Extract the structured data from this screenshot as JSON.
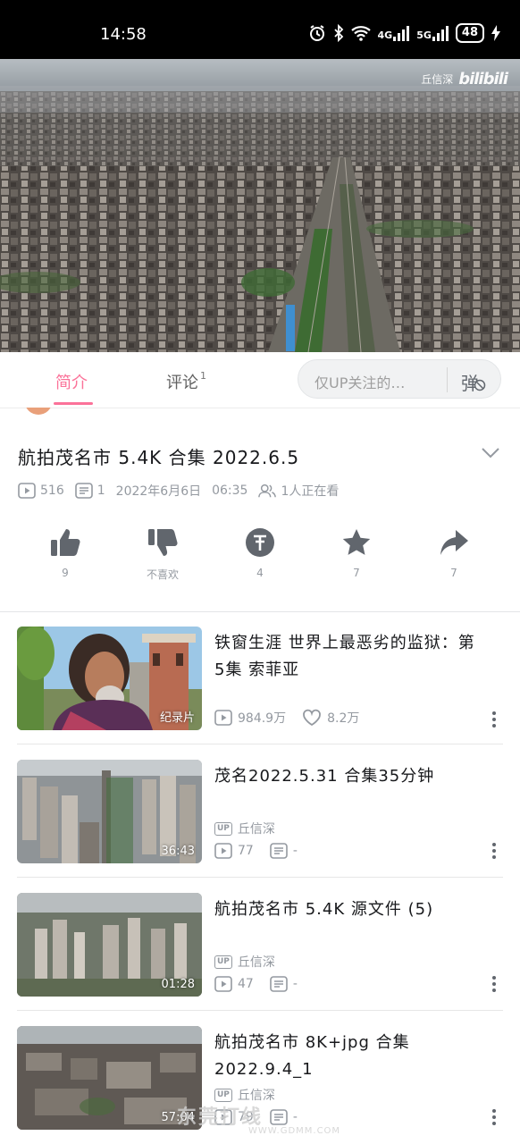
{
  "status_bar": {
    "time": "14:58",
    "network_4g": "4G",
    "network_5g": "5G",
    "battery": "48",
    "icons": [
      "alarm-icon",
      "bluetooth-icon",
      "wifi-icon",
      "signal-icon",
      "battery-icon",
      "charging-icon"
    ]
  },
  "video": {
    "uploader_watermark": "丘信深",
    "logo": "bilibili"
  },
  "tabs": {
    "intro": "简介",
    "comments": "评论",
    "comments_count": "1",
    "danmaku_placeholder": "仅UP关注的…",
    "danmaku_toggle": "弹"
  },
  "video_info": {
    "title": "航拍茂名市 5.4K 合集 2022.6.5",
    "views": "516",
    "danmaku_count": "1",
    "date": "2022年6月6日",
    "time": "06:35",
    "watching": "1人正在看"
  },
  "actions": [
    {
      "name": "like",
      "label": "9"
    },
    {
      "name": "dislike",
      "label": "不喜欢"
    },
    {
      "name": "coin",
      "label": "4"
    },
    {
      "name": "favorite",
      "label": "7"
    },
    {
      "name": "share",
      "label": "7"
    }
  ],
  "related": [
    {
      "title": "铁窗生涯 世界上最恶劣的监狱：第5集 索菲亚",
      "badge": "纪录片",
      "views": "984.9万",
      "likes": "8.2万"
    },
    {
      "title": "茂名2022.5.31  合集35分钟",
      "duration": "36:43",
      "up_badge": "UP",
      "uploader": "丘信深",
      "views": "77",
      "danmaku": "-"
    },
    {
      "title": "航拍茂名市 5.4K 源文件 (5)",
      "duration": "01:28",
      "up_badge": "UP",
      "uploader": "丘信深",
      "views": "47",
      "danmaku": "-"
    },
    {
      "title": "航拍茂名市 8K+jpg  合集 2022.9.4_1",
      "duration": "57:04",
      "up_badge": "UP",
      "uploader": "丘信深",
      "views": "79",
      "danmaku": "-"
    }
  ],
  "watermark": {
    "text": "东莞打线",
    "url": "WWW.GDMM.COM"
  },
  "colors": {
    "accent": "#fb7299",
    "icon_gray": "#61666d",
    "meta_gray": "#9499a0"
  }
}
